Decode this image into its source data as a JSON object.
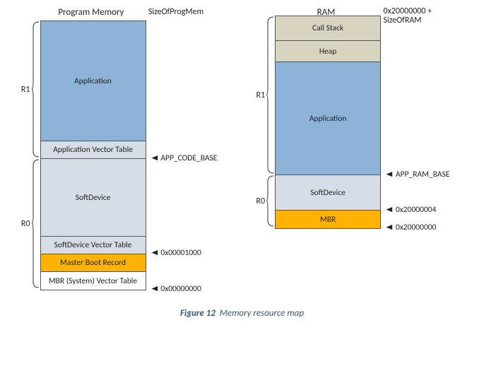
{
  "caption": {
    "figNum": "Figure 12",
    "title": "Memory resource map"
  },
  "prog": {
    "header": "Program Memory",
    "topAnnot": "SizeOfProgMem",
    "r1": "R1",
    "r0": "R0",
    "blocks": {
      "app": "Application",
      "avt": "Application Vector Table",
      "sd": "SoftDevice",
      "sdvt": "SoftDevice Vector Table",
      "mbr": "Master Boot Record",
      "mbrvt": "MBR (System) Vector Table"
    },
    "annots": {
      "appCodeBase": "APP_CODE_BASE",
      "addr1000": "0x00001000",
      "addr0000": "0x00000000"
    }
  },
  "ram": {
    "header": "RAM",
    "topAnnot1": "0x20000000 +",
    "topAnnot2": "SizeOfRAM",
    "r1": "R1",
    "r0": "R0",
    "blocks": {
      "callstack": "Call Stack",
      "heap": "Heap",
      "app": "Application",
      "sd": "SoftDevice",
      "mbr": "MBR"
    },
    "annots": {
      "appRamBase": "APP_RAM_BASE",
      "addr4": "0x20000004",
      "addr0": "0x20000000"
    }
  }
}
